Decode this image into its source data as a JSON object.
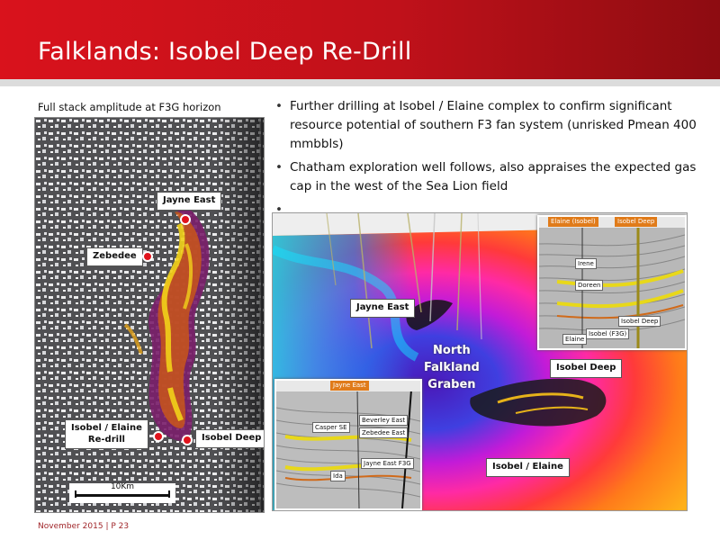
{
  "header": {
    "title": "Falklands: Isobel Deep Re-Drill"
  },
  "left": {
    "caption": "Full stack amplitude at F3G horizon",
    "labels": {
      "jayne_east": "Jayne East",
      "zebedee": "Zebedee",
      "isobel_elaine_line1": "Isobel / Elaine",
      "isobel_elaine_line2": "Re-drill",
      "isobel_deep": "Isobel Deep"
    },
    "scale": "10Km"
  },
  "bullets": [
    "Further drilling at Isobel / Elaine complex to confirm significant resource potential of southern F3 fan system (unrisked Pmean 400 mmbbls)",
    "Chatham exploration well follows, also appraises the expected gas cap in the west of the Sea Lion field",
    ""
  ],
  "right": {
    "labels": {
      "jayne_east": "Jayne East",
      "graben_line1": "North",
      "graben_line2": "Falkland",
      "graben_line3": "Graben",
      "isobel_deep": "Isobel Deep",
      "isobel_elaine": "Isobel / Elaine"
    },
    "inset_top": {
      "header_left": "Elaine (Isobel)",
      "header_right": "Isobel Deep",
      "tags": [
        "Irene",
        "Doreen",
        "Isobel Deep",
        "Elaine",
        "Isobel (F3G)"
      ]
    },
    "inset_bottom": {
      "header": "Jayne East",
      "tags": [
        "Casper SE",
        "Beverley East",
        "Zebedee East",
        "Jayne East F3G",
        "Ida"
      ]
    }
  },
  "footer": {
    "text": "November 2015 | P 23"
  },
  "colors": {
    "brand_red": "#d9121c",
    "dark_red": "#8d0c11",
    "marker_red": "#e0131c"
  }
}
